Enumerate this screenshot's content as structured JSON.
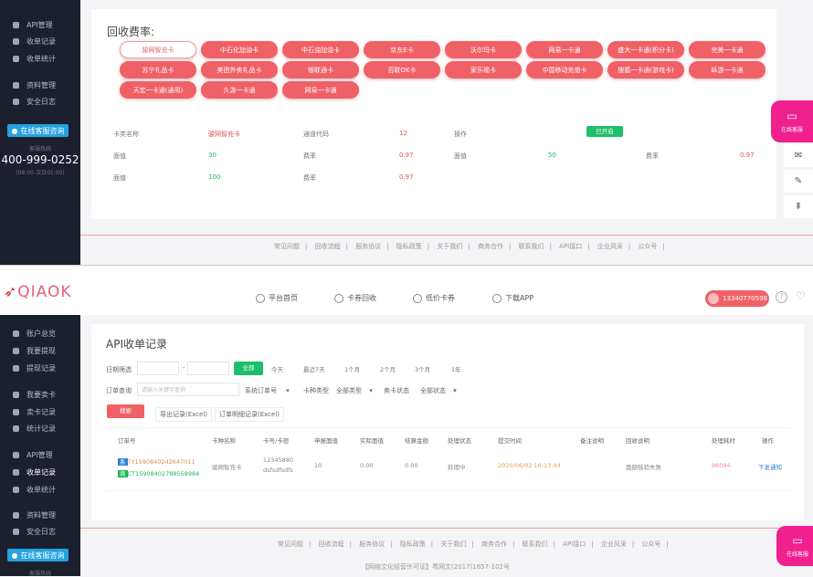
{
  "top": {
    "sidebar": {
      "items": [
        "API管理",
        "收单记录",
        "收单统计",
        "资料管理",
        "安全日志"
      ],
      "consult": "在线客服咨询",
      "hotline_label": "客服热线",
      "phone": "400-999-0252",
      "hours": "(08:00-次日01:00)"
    },
    "rate_title": "回收费率:",
    "rate_buttons": [
      "骏网智充卡",
      "中石化加油卡",
      "中石油加油卡",
      "京东E卡",
      "沃尔玛卡",
      "网易一卡通",
      "盛大一卡通(积分卡)",
      "完美一卡通",
      "苏宁礼品卡",
      "美团外卖礼品卡",
      "银联通卡",
      "百联OK卡",
      "家乐福卡",
      "中国移动充值卡",
      "搜狐一卡通(游戏卡)",
      "纵游一卡通",
      "天宏一卡通(通用)",
      "久游一卡通",
      "网易一卡通"
    ],
    "table": {
      "row1": {
        "l1": "卡类名称",
        "v1": "骏网智充卡",
        "l2": "通道代码",
        "v2": "12",
        "l3": "操作",
        "btn": "已开启"
      },
      "row2": {
        "l1": "面值",
        "v1": "30",
        "l2": "费率",
        "v2": "0.97",
        "l3": "面值",
        "v3": "50",
        "l4": "费率",
        "v4": "0.97"
      },
      "row3": {
        "l1": "面值",
        "v1": "100",
        "l2": "费率",
        "v2": "0.97"
      }
    },
    "footer_links": [
      "常见问题",
      "回收流程",
      "服务协议",
      "隐私政策",
      "关于我们",
      "商务合作",
      "联系我们",
      "API接口",
      "企业风采",
      "公众号"
    ],
    "float": {
      "label": "在线客服"
    }
  },
  "bottom": {
    "logo": "QIAOK",
    "nav": [
      "平台首页",
      "卡券回收",
      "低价卡券",
      "下载APP"
    ],
    "user_phone": "13340770598",
    "sidebar": {
      "items": [
        "账户总览",
        "我要提现",
        "提现记录",
        "我要卖卡",
        "卖卡记录",
        "统计记录",
        "API管理",
        "收单记录",
        "收单统计",
        "资料管理",
        "安全日志"
      ],
      "consult": "在线客服咨询",
      "hotline_label": "客服热线"
    },
    "title": "API收单记录",
    "date_label": "日期筛选",
    "date_sep": "-",
    "ranges": [
      "全部",
      "今天",
      "最近7天",
      "1个月",
      "2个月",
      "3个月",
      "1年"
    ],
    "order_label": "订单查询",
    "search_placeholder": "请输入关键字查询",
    "order_type": "系统订单号",
    "card_type_label": "卡种类型",
    "card_type": "全部类型",
    "status_label": "卖卡状态",
    "status": "全部状态",
    "search_btn": "搜索",
    "export1": "导出记录(Excel)",
    "export2": "订单明细记录(Excel)",
    "columns": [
      "订单号",
      "卡种名称",
      "卡号/卡密",
      "申报面值",
      "实际面值",
      "结算金额",
      "处理状态",
      "提交时间",
      "备注说明",
      "回收说明",
      "处理耗时",
      "操作"
    ],
    "rows": [
      {
        "tag1": "系",
        "order1": "TY1590840242647011",
        "tag2": "商",
        "order2": "CT15908402788558984",
        "card": "骏网智充卡",
        "cardno": "12345880",
        "cardpw": "dsfsdfsdfs",
        "declared": "10",
        "actual": "0.00",
        "amount": "0.00",
        "status": "处理中",
        "time": "2020/06/02 16:13:44",
        "note": "",
        "reason": "面额核验失败",
        "duration": "96094",
        "action": "下发通知"
      }
    ],
    "footer_links": [
      "常见问题",
      "回收流程",
      "服务协议",
      "隐私政策",
      "关于我们",
      "商务合作",
      "联系我们",
      "API接口",
      "企业风采",
      "公众号"
    ],
    "copyright": "【网络文化经营许可证】粤网文(2017)1657-102号",
    "float": {
      "label": "在线客服"
    }
  }
}
